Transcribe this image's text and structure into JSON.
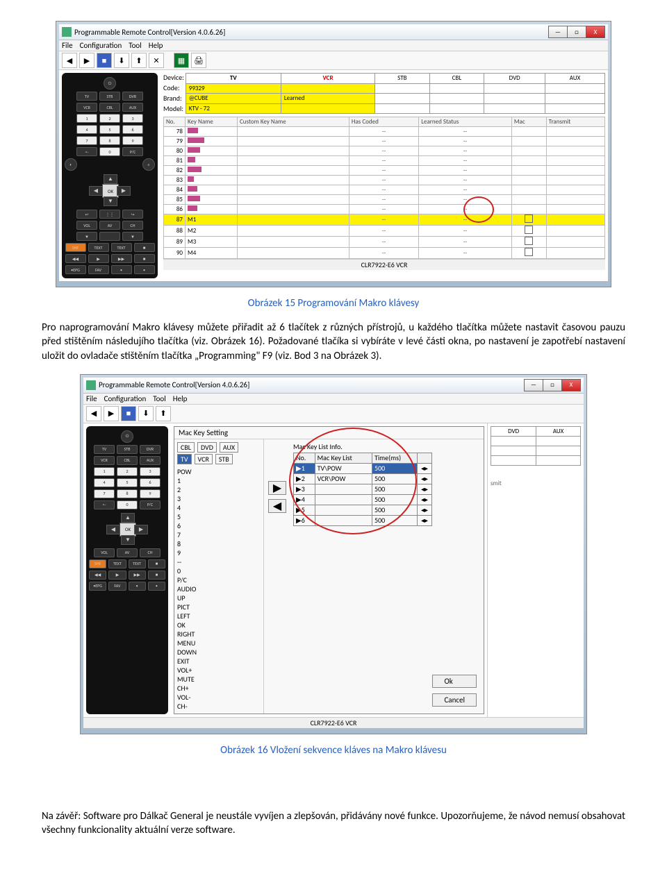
{
  "app": {
    "title": "Programmable Remote Control[Version 4.0.6.26]",
    "menu": [
      "File",
      "Configuration",
      "Tool",
      "Help"
    ]
  },
  "figure1": {
    "device_labels": [
      "Device:",
      "Code:",
      "Brand:",
      "Model:"
    ],
    "device_headers": [
      "TV",
      "VCR",
      "STB",
      "CBL",
      "DVD",
      "AUX"
    ],
    "device_rows": {
      "code": [
        "99329",
        "",
        "",
        " ",
        " ",
        " "
      ],
      "brand": [
        "@CUBE",
        "Learned",
        "",
        "",
        "",
        ""
      ],
      "model": [
        "KTV - 72",
        "",
        "",
        "",
        "",
        ""
      ]
    },
    "key_headers": [
      "No.",
      "Key Name",
      "Custom Key Name",
      "Has Coded",
      "Learned Status",
      "Mac",
      "Transmit"
    ],
    "rows": [
      {
        "no": "78",
        "hasCoded": "--",
        "learned": "--"
      },
      {
        "no": "79",
        "hasCoded": "--",
        "learned": "--"
      },
      {
        "no": "80",
        "hasCoded": "--",
        "learned": "--"
      },
      {
        "no": "81",
        "hasCoded": "--",
        "learned": "--"
      },
      {
        "no": "82",
        "hasCoded": "--",
        "learned": "--"
      },
      {
        "no": "83",
        "hasCoded": "--",
        "learned": "--"
      },
      {
        "no": "84",
        "hasCoded": "--",
        "learned": "--"
      },
      {
        "no": "85",
        "hasCoded": "--",
        "learned": "--"
      },
      {
        "no": "86",
        "hasCoded": "--",
        "learned": "--"
      },
      {
        "no": "87",
        "kn": "M1",
        "hasCoded": "--",
        "learned": "--",
        "hl": true
      },
      {
        "no": "88",
        "kn": "M2",
        "hasCoded": "--",
        "learned": "--"
      },
      {
        "no": "89",
        "kn": "M3",
        "hasCoded": "--",
        "learned": "--"
      },
      {
        "no": "90",
        "kn": "M4",
        "hasCoded": "--",
        "learned": "--"
      }
    ],
    "status": "CLR7922-E6        VCR"
  },
  "caption1": "Obrázek 15 Programování Makro klávesy",
  "para1": "Pro naprogramování Makro klávesy můžete přiřadit až 6 tlačítek z různých přístrojů, u každého tlačítka můžete nastavit časovou pauzu před stištěním následujího tlačítka (viz. Obrázek 16). Požadované tlačíka si vybíráte v levé části okna, po nastavení je zapotřebí nastavení uložit do ovladače stištěním tlačítka „Programming\" F9 (viz. Bod 3 na Obrázek 3).",
  "figure2": {
    "dialog_title": "Mac Key Setting",
    "dev_row1": [
      "CBL",
      "DVD",
      "AUX"
    ],
    "dev_row2": [
      "TV",
      "VCR",
      "STB"
    ],
    "dev_sel": "TV",
    "keylist": [
      "POW",
      "1",
      "2",
      "3",
      "4",
      "5",
      "6",
      "7",
      "8",
      "9",
      "--",
      "0",
      "P/C",
      "AUDIO",
      "UP",
      "PICT",
      "LEFT",
      "OK",
      "RIGHT",
      "MENU",
      "DOWN",
      "EXIT",
      "VOL+",
      "MUTE",
      "CH+",
      "VOL-",
      "CH-"
    ],
    "mac_title": "Mac Key List Info.",
    "mac_headers": [
      "No.",
      "Mac Key List",
      "Time(ms)"
    ],
    "mac_rows": [
      {
        "no": "1",
        "k": "TV\\POW",
        "t": "500",
        "sel": true
      },
      {
        "no": "2",
        "k": "VCR\\POW",
        "t": "500"
      },
      {
        "no": "3",
        "k": "",
        "t": "500"
      },
      {
        "no": "4",
        "k": "",
        "t": "500"
      },
      {
        "no": "5",
        "k": "",
        "t": "500"
      },
      {
        "no": "6",
        "k": "",
        "t": "500"
      }
    ],
    "ok": "Ok",
    "cancel": "Cancel",
    "right_headers": [
      "DVD",
      "AUX"
    ],
    "status": "CLR7922-E6        VCR"
  },
  "caption2": "Obrázek 16 Vložení sekvence kláves na Makro klávesu",
  "para2": "Na závěř: Software pro Dálkač General je neustále vyvíjen a zlepšován, přidávány nové funkce. Upozorňujeme, že návod nemusí obsahovat všechny  funkcionality aktuální verze software.",
  "icons": {
    "minimize": "—",
    "maximize": "□",
    "close": "X"
  }
}
